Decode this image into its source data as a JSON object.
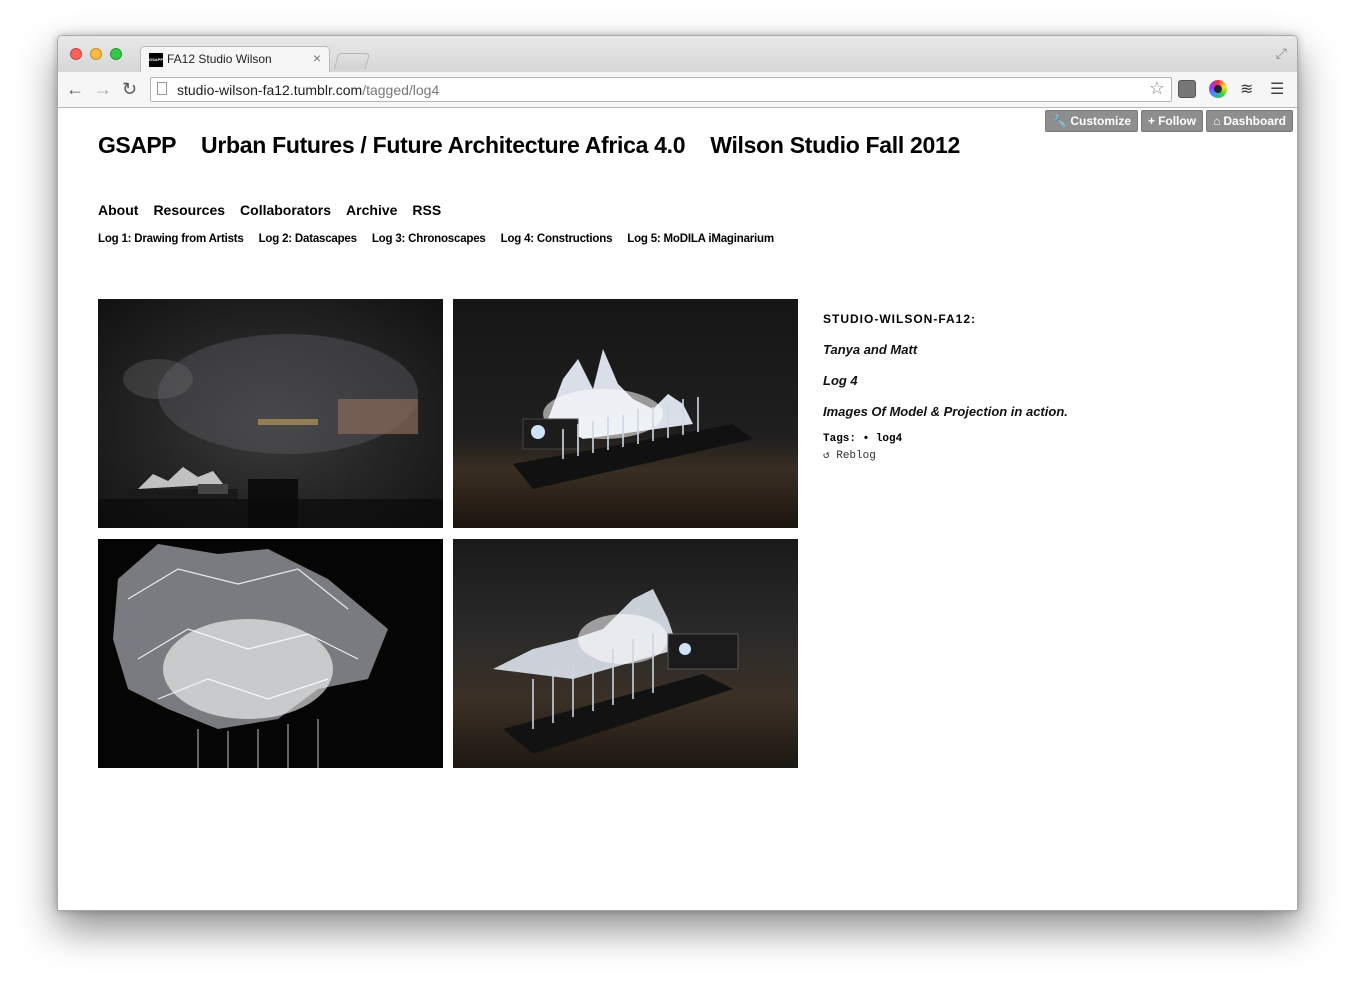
{
  "browser": {
    "tab_title": "FA12 Studio Wilson",
    "tab_favicon_text": "GSAPP",
    "url_host": "studio-wilson-fa12.tumblr.com",
    "url_path": "/tagged/log4"
  },
  "tumblr_controls": {
    "customize": "Customize",
    "follow": "Follow",
    "dashboard": "Dashboard"
  },
  "header": {
    "logo": "GSAPP",
    "title": "Urban Futures / Future Architecture Africa 4.0",
    "subtitle": "Wilson Studio Fall 2012"
  },
  "nav": {
    "items": [
      "About",
      "Resources",
      "Collaborators",
      "Archive",
      "RSS"
    ]
  },
  "lognav": {
    "items": [
      "Log 1: Drawing from Artists",
      "Log 2: Datascapes",
      "Log 3: Chronoscapes",
      "Log 4: Constructions",
      "Log 5: MoDILA iMaginarium"
    ]
  },
  "post": {
    "author": "STUDIO-WILSON-FA12:",
    "line1": "Tanya and Matt",
    "line2": "Log 4",
    "line3": "Images Of Model & Projection in action.",
    "tags_label": "Tags:",
    "tag": "• log4",
    "reblog": "Reblog"
  }
}
